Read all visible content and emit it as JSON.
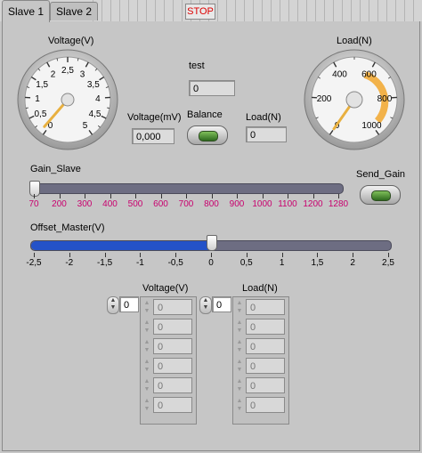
{
  "tabs": [
    {
      "label": "Slave 1",
      "active": true
    },
    {
      "label": "Slave 2",
      "active": false
    }
  ],
  "stop_label": "STOP",
  "gauge_voltage": {
    "label": "Voltage(V)",
    "ticks": [
      "0",
      "0,5",
      "1",
      "1,5",
      "2",
      "2,5",
      "3",
      "3,5",
      "4",
      "4,5",
      "5"
    ],
    "value": 0.1
  },
  "gauge_load": {
    "label": "Load(N)",
    "ticks": [
      "0",
      "200",
      "400",
      "600",
      "800",
      "1000"
    ],
    "value": 0
  },
  "test": {
    "label": "test",
    "value": "0"
  },
  "voltage_mv": {
    "label": "Voltage(mV)",
    "value": "0,000"
  },
  "balance": {
    "label": "Balance"
  },
  "load_n": {
    "label": "Load(N)",
    "value": "0"
  },
  "gain_slave": {
    "label": "Gain_Slave",
    "ticks": [
      "70",
      "200",
      "300",
      "400",
      "500",
      "600",
      "700",
      "800",
      "900",
      "1000",
      "1100",
      "1200",
      "1280"
    ],
    "tick_values": [
      70,
      200,
      300,
      400,
      500,
      600,
      700,
      800,
      900,
      1000,
      1100,
      1200,
      1280
    ],
    "value": 70
  },
  "send_gain": {
    "label": "Send_Gain"
  },
  "offset_master": {
    "label": "Offset_Master(V)",
    "ticks": [
      "-2,5",
      "-2",
      "-1,5",
      "-1",
      "-0,5",
      "0",
      "0,5",
      "1",
      "1,5",
      "2",
      "2,5"
    ],
    "value": 0
  },
  "voltage_array": {
    "label": "Voltage(V)",
    "index": "0",
    "values": [
      "0",
      "0",
      "0",
      "0",
      "0",
      "0"
    ]
  },
  "load_array": {
    "label": "Load(N)",
    "index": "0",
    "values": [
      "0",
      "0",
      "0",
      "0",
      "0",
      "0"
    ]
  },
  "colors": {
    "accent_blue": "#2452c8",
    "tick_pink": "#c8006e",
    "led_green": "#3f8a2a",
    "needle": "#e8b040"
  }
}
